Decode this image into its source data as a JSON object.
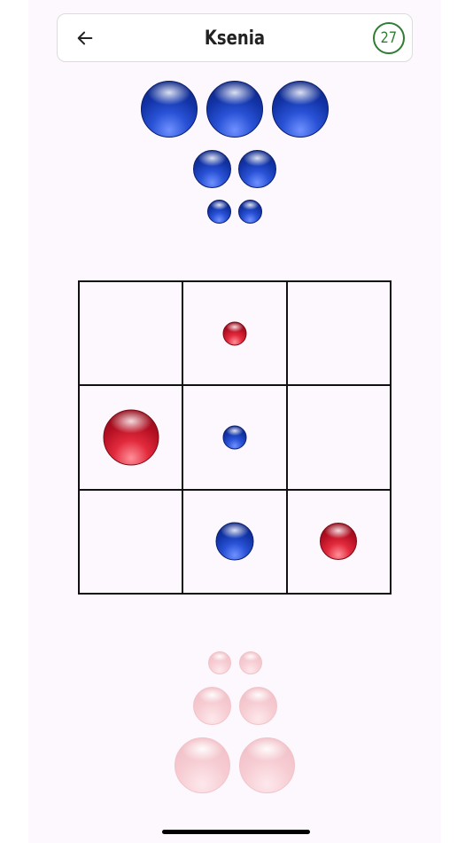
{
  "header": {
    "back_icon": "arrow-left-icon",
    "title": "Ksenia",
    "timer": "27",
    "timer_color": "#2e7d32"
  },
  "colors": {
    "blue": "#1233a6",
    "red": "#d11f33",
    "pink_faded": "#f6cdd3",
    "grid": "#111111",
    "background": "#fdf8fd"
  },
  "opponent_reserve": {
    "color": "blue",
    "pieces": {
      "large": 3,
      "medium": 2,
      "small": 2
    }
  },
  "board": {
    "rows": 3,
    "cols": 3,
    "cells": [
      {
        "row": 1,
        "col": 1,
        "piece": null
      },
      {
        "row": 1,
        "col": 2,
        "piece": {
          "color": "red",
          "size": "small"
        }
      },
      {
        "row": 1,
        "col": 3,
        "piece": null
      },
      {
        "row": 2,
        "col": 1,
        "piece": {
          "color": "red",
          "size": "large"
        }
      },
      {
        "row": 2,
        "col": 2,
        "piece": {
          "color": "blue",
          "size": "small"
        }
      },
      {
        "row": 2,
        "col": 3,
        "piece": null
      },
      {
        "row": 3,
        "col": 1,
        "piece": null
      },
      {
        "row": 3,
        "col": 2,
        "piece": {
          "color": "blue",
          "size": "medium"
        }
      },
      {
        "row": 3,
        "col": 3,
        "piece": {
          "color": "red",
          "size": "medium"
        }
      }
    ]
  },
  "player_reserve": {
    "color": "red",
    "state": "inactive",
    "pieces": {
      "large": 2,
      "medium": 2,
      "small": 2
    }
  }
}
